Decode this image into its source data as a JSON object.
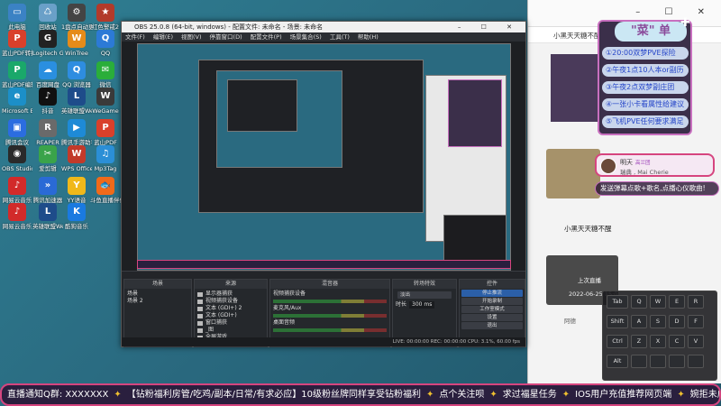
{
  "desktop_icons": [
    {
      "label": "此电脑",
      "color": "#3b82c4",
      "glyph": "▭",
      "icon": "computer-icon"
    },
    {
      "label": "回收站",
      "color": "#6aa0c8",
      "glyph": "♺",
      "icon": "recycle-bin-icon"
    },
    {
      "label": "1盘点自动更新脚本.bat",
      "color": "#444",
      "glyph": "⚙",
      "icon": "script-icon"
    },
    {
      "label": "红色警戒2",
      "color": "#b23a2a",
      "glyph": "★",
      "icon": "game-icon"
    },
    {
      "label": "蓝山PDF转换器",
      "color": "#d9402b",
      "glyph": "P",
      "icon": "pdf-icon"
    },
    {
      "label": "Logitech G HUB",
      "color": "#222",
      "glyph": "G",
      "icon": "logitech-icon"
    },
    {
      "label": "WinTree",
      "color": "#e58b1a",
      "glyph": "W",
      "icon": "app-icon"
    },
    {
      "label": "QQ",
      "color": "#2c7ad6",
      "glyph": "Q",
      "icon": "qq-icon"
    },
    {
      "label": "蓝山PDF编辑器",
      "color": "#1aa86a",
      "glyph": "P",
      "icon": "pdf-editor-icon"
    },
    {
      "label": "百度网盘",
      "color": "#2a8fe0",
      "glyph": "☁",
      "icon": "cloud-icon"
    },
    {
      "label": "QQ 浏览器",
      "color": "#2e8de0",
      "glyph": "Q",
      "icon": "browser-icon"
    },
    {
      "label": "微信",
      "color": "#2aae3a",
      "glyph": "✉",
      "icon": "wechat-icon"
    },
    {
      "label": "Microsoft Edge",
      "color": "#1c8fc8",
      "glyph": "e",
      "icon": "edge-icon"
    },
    {
      "label": "抖音",
      "color": "#111",
      "glyph": "♪",
      "icon": "douyin-icon"
    },
    {
      "label": "英雄联盟WeGame版",
      "color": "#1e4c8a",
      "glyph": "L",
      "icon": "lol-icon"
    },
    {
      "label": "WeGame",
      "color": "#3a3a3a",
      "glyph": "W",
      "icon": "wegame-icon"
    },
    {
      "label": "腾讯会议",
      "color": "#2b6de0",
      "glyph": "▣",
      "icon": "meeting-icon"
    },
    {
      "label": "REAPER",
      "color": "#6a6a6a",
      "glyph": "R",
      "icon": "reaper-icon"
    },
    {
      "label": "腾讯手游助手",
      "color": "#1e8ad6",
      "glyph": "▶",
      "icon": "game-assist-icon"
    },
    {
      "label": "蓝山PDF",
      "color": "#d9402b",
      "glyph": "P",
      "icon": "pdf-icon-2"
    },
    {
      "label": "OBS Studio",
      "color": "#2a2a2a",
      "glyph": "◉",
      "icon": "obs-icon"
    },
    {
      "label": "爱剪辑",
      "color": "#3aa34a",
      "glyph": "✂",
      "icon": "editor-icon"
    },
    {
      "label": "WPS Office",
      "color": "#c23a2a",
      "glyph": "W",
      "icon": "wps-icon"
    },
    {
      "label": "Mp3Tag",
      "color": "#2b8fd6",
      "glyph": "♫",
      "icon": "mp3-icon"
    },
    {
      "label": "网易云音乐",
      "color": "#d22a2a",
      "glyph": "♪",
      "icon": "netease-icon"
    },
    {
      "label": "腾讯加速器",
      "color": "#2a6ad6",
      "glyph": "»",
      "icon": "accelerator-icon"
    },
    {
      "label": "YY语音",
      "color": "#f0b81a",
      "glyph": "Y",
      "icon": "yy-icon"
    },
    {
      "label": "斗鱼直播伴侣",
      "color": "#f06a1a",
      "glyph": "🐟",
      "icon": "douyu-icon"
    },
    {
      "label": "网易云音乐",
      "color": "#d22a2a",
      "glyph": "♪",
      "icon": "netease-icon-2"
    },
    {
      "label": "英雄联盟WeGame版",
      "color": "#1e4c8a",
      "glyph": "L",
      "icon": "lol-icon-2"
    },
    {
      "label": "酷狗音乐",
      "color": "#1a7ae0",
      "glyph": "K",
      "icon": "kugou-icon"
    }
  ],
  "obs": {
    "title": "OBS 25.0.8 (64-bit, windows) - 配置文件: 未命名 - 场景: 未命名",
    "menu": [
      "文件(F)",
      "编辑(E)",
      "视图(V)",
      "停靠窗口(D)",
      "配置文件(P)",
      "场景集合(S)",
      "工具(T)",
      "帮助(H)"
    ],
    "docks": {
      "scenes": {
        "title": "场景",
        "items": [
          "场景",
          "场景 2"
        ]
      },
      "sources": {
        "title": "来源",
        "items": [
          "显示器捕获",
          "视频捕获设备",
          "文本 (GDI+) 2",
          "文本 (GDI+)",
          "窗口捕获",
          "_图",
          "全屏游戏"
        ]
      },
      "mixer": {
        "title": "混音器",
        "channels": [
          "视频捕获设备",
          "麦克风/Aux",
          "桌面音频"
        ]
      },
      "transitions": {
        "title": "转场特效",
        "value": "淡出",
        "duration_label": "时长",
        "duration": "300 ms"
      },
      "controls": {
        "title": "控件",
        "buttons": [
          "停止推流",
          "开始录制",
          "工作室模式",
          "设置",
          "退出"
        ]
      }
    },
    "status": "LIVE: 00:00:00   REC: 00:00:00   CPU: 3.1%, 60.00 fps"
  },
  "menu_overlay": {
    "title": "\"菜\" 单",
    "items": [
      "①20:00双梦PVE探险",
      "②午夜1点10人本or副历",
      "③午夜2点双梦副庄团",
      "④一张小卡看属性给建议",
      "⑤飞机PVE任何要求满足"
    ]
  },
  "chat": {
    "name": "明天",
    "badge": "高兰团",
    "message": "瑞典 , Mai Cherie",
    "hint": "发送弹幕点歌+歌名,点播心仪歌曲!"
  },
  "browser": {
    "tab_title": "小黑天天糖不醒",
    "feed_text": [
      "小黑天天糖不醒",
      "上次直播",
      "2022-06-25 15:00",
      "阿德"
    ]
  },
  "keyboard": {
    "rows": [
      [
        "Tab",
        "Q",
        "W",
        "E",
        "R"
      ],
      [
        "Shift",
        "A",
        "S",
        "D",
        "F"
      ],
      [
        "Ctrl",
        "Z",
        "X",
        "C",
        "V"
      ],
      [
        "Alt",
        "",
        "",
        "",
        ""
      ]
    ]
  },
  "ticker": {
    "segments": [
      "直播通知Q群: XXXXXXX",
      "【钻粉福利房管/吃鸡/副本/日常/有求必应】10级粉丝牌同样享受钻粉福利",
      "点个关注呗",
      "求过福星任务",
      "IOS用户充值推荐网页端",
      "婉拒未成年消费打赏"
    ]
  },
  "colors": {
    "accent": "#d6457f",
    "menu_text": "#2545c9",
    "panel": "#3b2f4a"
  }
}
